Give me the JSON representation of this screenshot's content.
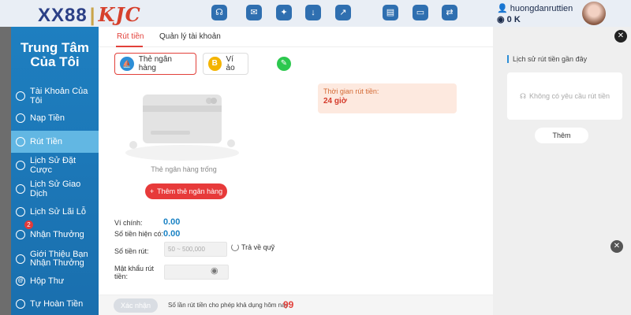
{
  "site": {
    "logo_main": "XX88",
    "logo_brand": "KJC",
    "username": "huongdanruttien",
    "balance": "0 K"
  },
  "sidebar": {
    "title_line1": "Trung Tâm",
    "title_line2": "Của Tôi",
    "items": [
      {
        "label": "Tài Khoản Của Tôi"
      },
      {
        "label": "Nạp Tiền"
      },
      {
        "label": "Rút Tiền"
      },
      {
        "label": "Lịch Sử Đặt Cược"
      },
      {
        "label": "Lịch Sử Giao Dịch"
      },
      {
        "label": "Lịch Sử Lãi Lỗ"
      },
      {
        "label": "Nhận Thưởng",
        "badge": "2"
      },
      {
        "label": "Giới Thiệu Bạn Nhận Thưởng"
      },
      {
        "label": "Hộp Thư"
      },
      {
        "label": "Tự Hoàn Tiền"
      }
    ]
  },
  "tabs": [
    {
      "label": "Rút tiền"
    },
    {
      "label": "Quản lý tài khoản"
    }
  ],
  "methods": {
    "bank": "Thẻ ngân hàng",
    "ewallet": "Ví ảo"
  },
  "empty_bank": {
    "text": "Thẻ ngân hàng trống",
    "add_button": "Thêm thẻ ngân hàng"
  },
  "withdraw_time": {
    "label": "Thời gian rút tiền:",
    "value": "24 giờ"
  },
  "form": {
    "main_wallet_label": "Ví chính:",
    "main_wallet_value": "0.00",
    "current_balance_label": "Số tiền hiện có:",
    "current_balance_value": "0.00",
    "amount_label": "Số tiền rút:",
    "amount_placeholder": "50 ~ 500,000",
    "refund_label": "Trả về quỹ",
    "password_label": "Mật khẩu rút tiền:"
  },
  "footer": {
    "confirm": "Xác nhận",
    "note": "Số lần rút tiền cho phép khả dụng hôm nay:",
    "count": "99"
  },
  "history": {
    "title": "Lịch sử rút tiền gần đây",
    "empty": "Không có yêu cầu rút tiền",
    "more": "Thêm"
  },
  "colors": {
    "sidebar": "#1e7fc0",
    "accent": "#e2403a",
    "active_item": "#62b7e3"
  }
}
